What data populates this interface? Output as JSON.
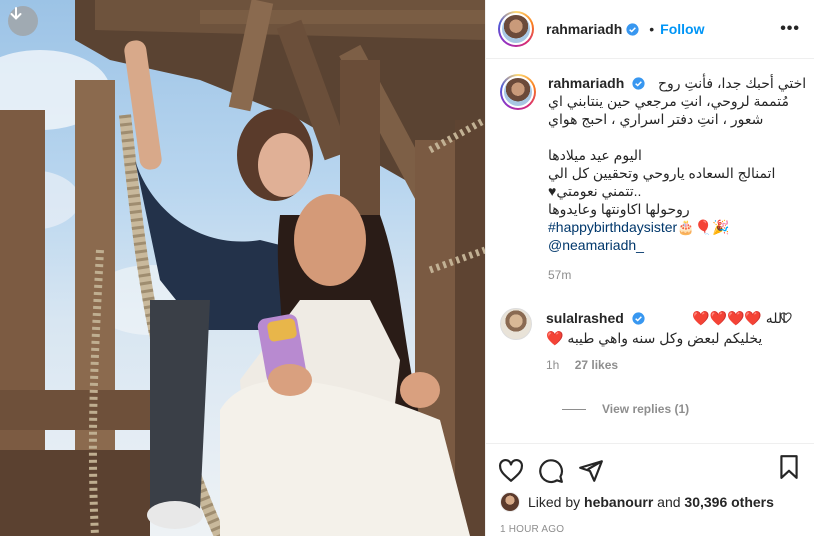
{
  "header": {
    "username": "rahmariadh",
    "separator": "•",
    "follow_label": "Follow",
    "more_label": "•••"
  },
  "caption": {
    "username": "rahmariadh",
    "lines": [
      "اختي أحبك جدا، فأنتِ روح",
      "مُتممة لروحي، انتِ مرجعي حين ينتابني اي",
      "شعور ، انتِ دفتر اسراري ، احبج هواي",
      "",
      "اليوم عيد ميلادها",
      "اتمنالج السعاده ياروحي وتحقيين كل الي",
      "..تتمني نعومتي♥",
      "روحولها اكاونتها وعايدوها"
    ],
    "hashtag": "#happybirthdaysister",
    "hashtag_emoji": "🎂🎈🎉",
    "mention": "@neamariadh_",
    "time": "57m"
  },
  "comment": {
    "username": "sulalrashed",
    "line1": "الله ❤️❤️❤️❤️",
    "line2": "يخليكم لبعض وكل سنه واهي طيبه ❤️",
    "time": "1h",
    "likes": "27 likes",
    "view_replies": "View replies (1)"
  },
  "likes": {
    "prefix": "Liked by",
    "user": "hebanourr",
    "and": "and",
    "others": "30,396 others"
  },
  "posted_ago": "1 HOUR AGO",
  "colors": {
    "accent": "#0095f6",
    "verified": "#3897f0",
    "heart": "#ed4956"
  },
  "icons": [
    "download-icon",
    "verified-badge-icon",
    "more-icon",
    "heart-icon",
    "comment-icon",
    "share-icon",
    "save-icon"
  ]
}
